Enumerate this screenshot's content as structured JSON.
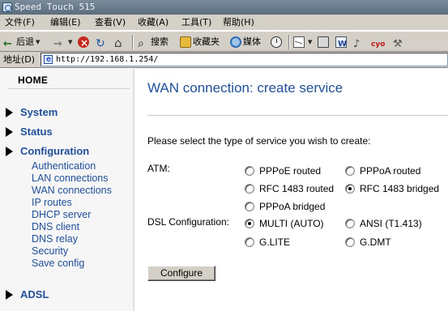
{
  "window": {
    "title": "Speed Touch 515"
  },
  "menu": [
    "文件(F)",
    "编辑(E)",
    "查看(V)",
    "收藏(A)",
    "工具(T)",
    "帮助(H)"
  ],
  "toolbar": {
    "back": "后退",
    "search": "搜索",
    "favorites": "收藏夹",
    "media": "媒体",
    "messenger": "cyo"
  },
  "address": {
    "label": "地址(D)",
    "url": "http://192.168.1.254/"
  },
  "sidebar": {
    "header": "HOME",
    "sections": [
      {
        "label": "System"
      },
      {
        "label": "Status"
      },
      {
        "label": "Configuration"
      }
    ],
    "config_items": [
      "Authentication",
      "LAN connections",
      "WAN connections",
      "IP routes",
      "DHCP server",
      "DNS client",
      "DNS relay",
      "Security",
      "Save config"
    ],
    "adsl": "ADSL"
  },
  "main": {
    "title": "WAN connection: create service",
    "instruction": "Please select the type of service you wish to create:",
    "atm": {
      "label": "ATM:",
      "options": [
        "PPPoE routed",
        "PPPoA routed",
        "RFC 1483 routed",
        "RFC 1483 bridged",
        "PPPoA bridged"
      ],
      "selected": "RFC 1483 bridged"
    },
    "dsl": {
      "label": "DSL Configuration:",
      "options": [
        "MULTI (AUTO)",
        "ANSI (T1.413)",
        "G.LITE",
        "G.DMT"
      ],
      "selected": "MULTI (AUTO)"
    },
    "configure_label": "Configure"
  },
  "colors": {
    "link": "#1f4f98",
    "chrome": "#d4d0c8"
  }
}
